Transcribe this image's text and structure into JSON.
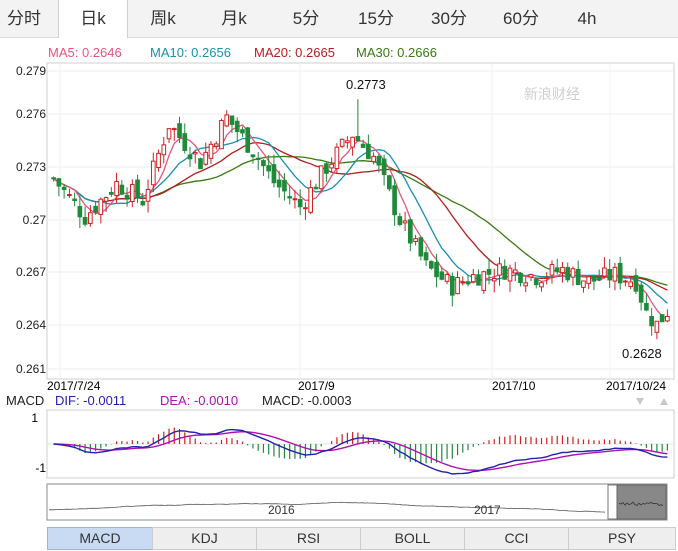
{
  "period_tabs": [
    {
      "label": "分时",
      "active": false
    },
    {
      "label": "日k",
      "active": true
    },
    {
      "label": "周k",
      "active": false
    },
    {
      "label": "月k",
      "active": false
    },
    {
      "label": "5分",
      "active": false
    },
    {
      "label": "15分",
      "active": false
    },
    {
      "label": "30分",
      "active": false
    },
    {
      "label": "60分",
      "active": false
    },
    {
      "label": "4h",
      "active": false
    }
  ],
  "ma_legend": [
    {
      "label": "MA5: 0.2646",
      "color": "#e8547a"
    },
    {
      "label": "MA10: 0.2656",
      "color": "#1a8fb0"
    },
    {
      "label": "MA20: 0.2665",
      "color": "#b01f1f"
    },
    {
      "label": "MA30: 0.2666",
      "color": "#3a7a12"
    }
  ],
  "watermark": "新浪财经",
  "price_axis": {
    "ticks": [
      "0.279",
      "0.276",
      "0.273",
      "0.27",
      "0.267",
      "0.264",
      "0.261"
    ]
  },
  "date_axis": {
    "ticks": [
      "2017/7/24",
      "2017/9",
      "2017/10",
      "2017/10/24"
    ]
  },
  "annotations": {
    "high": "0.2773",
    "low": "0.2628"
  },
  "macd_legend": [
    {
      "label": "MACD",
      "color": "#222"
    },
    {
      "label": "DIF: -0.0011",
      "color": "#2222aa"
    },
    {
      "label": "DEA: -0.0010",
      "color": "#b010b0"
    },
    {
      "label": "MACD: -0.0003",
      "color": "#222"
    }
  ],
  "macd_axis": {
    "ticks": [
      "1",
      "-1"
    ]
  },
  "navigator": {
    "years": [
      "2016",
      "2017"
    ]
  },
  "colors": {
    "up": "#d02020",
    "down": "#1e8a3a"
  },
  "indicator_tabs": [
    {
      "label": "MACD",
      "active": true
    },
    {
      "label": "KDJ",
      "active": false
    },
    {
      "label": "RSI",
      "active": false
    },
    {
      "label": "BOLL",
      "active": false
    },
    {
      "label": "CCI",
      "active": false
    },
    {
      "label": "PSY",
      "active": false
    }
  ]
}
